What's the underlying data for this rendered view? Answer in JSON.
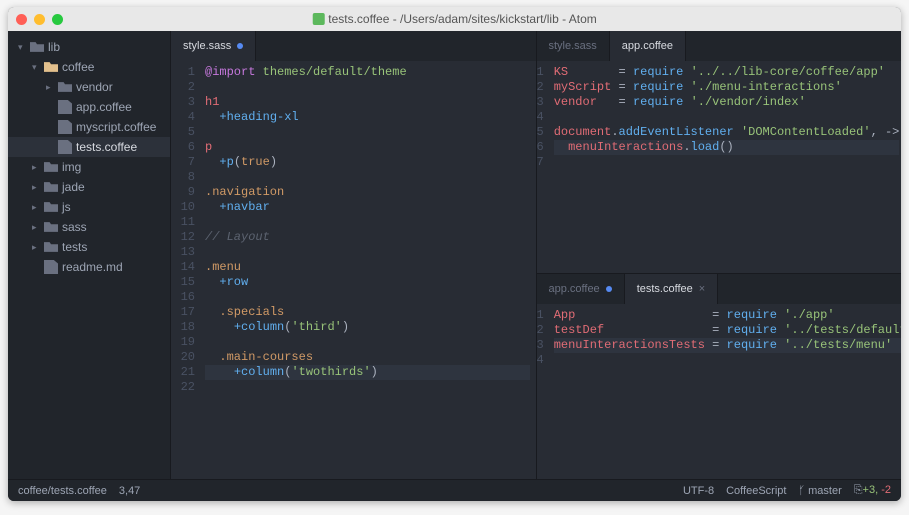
{
  "window": {
    "title": "tests.coffee - /Users/adam/sites/kickstart/lib - Atom"
  },
  "sidebar": {
    "items": [
      {
        "label": "lib",
        "type": "folder",
        "open": true,
        "indent": 0,
        "chev": "▾"
      },
      {
        "label": "coffee",
        "type": "folder-open",
        "open": true,
        "indent": 1,
        "chev": "▾"
      },
      {
        "label": "vendor",
        "type": "folder",
        "open": false,
        "indent": 2,
        "chev": "▸"
      },
      {
        "label": "app.coffee",
        "type": "file",
        "indent": 2
      },
      {
        "label": "myscript.coffee",
        "type": "file",
        "indent": 2
      },
      {
        "label": "tests.coffee",
        "type": "file",
        "indent": 2,
        "selected": true
      },
      {
        "label": "img",
        "type": "folder",
        "open": false,
        "indent": 1,
        "chev": "▸"
      },
      {
        "label": "jade",
        "type": "folder",
        "open": false,
        "indent": 1,
        "chev": "▸"
      },
      {
        "label": "js",
        "type": "folder",
        "open": false,
        "indent": 1,
        "chev": "▸"
      },
      {
        "label": "sass",
        "type": "folder",
        "open": false,
        "indent": 1,
        "chev": "▸"
      },
      {
        "label": "tests",
        "type": "folder",
        "open": false,
        "indent": 1,
        "chev": "▸"
      },
      {
        "label": "readme.md",
        "type": "file",
        "indent": 1
      }
    ]
  },
  "leftPane": {
    "tabs": [
      {
        "label": "style.sass",
        "active": true,
        "modified": true
      }
    ],
    "lines": [
      {
        "n": "1",
        "html": "<span class='c-kw'>@import</span> <span class='c-str'>themes/default/theme</span>"
      },
      {
        "n": "2",
        "html": ""
      },
      {
        "n": "3",
        "html": "<span class='c-tag'>h1</span>"
      },
      {
        "n": "4",
        "html": "  <span class='c-mix'>+heading-xl</span>"
      },
      {
        "n": "5",
        "html": ""
      },
      {
        "n": "6",
        "html": "<span class='c-tag'>p</span>"
      },
      {
        "n": "7",
        "html": "  <span class='c-mix'>+p</span>(<span class='c-bool'>true</span>)"
      },
      {
        "n": "8",
        "html": ""
      },
      {
        "n": "9",
        "html": "<span class='c-class'>.navigation</span>"
      },
      {
        "n": "10",
        "html": "  <span class='c-mix'>+navbar</span>"
      },
      {
        "n": "11",
        "html": ""
      },
      {
        "n": "12",
        "html": "<span class='c-comment'>// Layout</span>"
      },
      {
        "n": "13",
        "html": ""
      },
      {
        "n": "14",
        "html": "<span class='c-class'>.menu</span>"
      },
      {
        "n": "15",
        "html": "  <span class='c-mix'>+row</span>"
      },
      {
        "n": "16",
        "html": ""
      },
      {
        "n": "17",
        "html": "  <span class='c-class'>.specials</span>"
      },
      {
        "n": "18",
        "html": "    <span class='c-mix'>+column</span>(<span class='c-str'>'third'</span>)"
      },
      {
        "n": "19",
        "html": ""
      },
      {
        "n": "20",
        "html": "  <span class='c-class'>.main-courses</span>"
      },
      {
        "n": "21",
        "html": "    <span class='c-mix'>+column</span>(<span class='c-str'>'twothirds'</span>)",
        "hl": true
      },
      {
        "n": "22",
        "html": ""
      }
    ]
  },
  "topRightPane": {
    "tabs": [
      {
        "label": "style.sass",
        "active": false
      },
      {
        "label": "app.coffee",
        "active": true
      }
    ],
    "lines": [
      {
        "n": "1",
        "html": "<span class='c-var'>KS</span>       <span class='c-op'>=</span> <span class='c-func'>require</span> <span class='c-str'>'../../lib-core/coffee/app'</span>"
      },
      {
        "n": "2",
        "html": "<span class='c-var'>myScript</span> <span class='c-op'>=</span> <span class='c-func'>require</span> <span class='c-str'>'./menu-interactions'</span>"
      },
      {
        "n": "3",
        "html": "<span class='c-var'>vendor</span>   <span class='c-op'>=</span> <span class='c-func'>require</span> <span class='c-str'>'./vendor/index'</span>"
      },
      {
        "n": "4",
        "html": ""
      },
      {
        "n": "5",
        "html": "<span class='c-var'>document</span>.<span class='c-func'>addEventListener</span> <span class='c-str'>'DOMContentLoaded'</span>, <span class='c-op'>-&gt;</span>"
      },
      {
        "n": "6",
        "html": "  <span class='c-var'>menuInteractions</span>.<span class='c-func'>load</span>()",
        "hl": true
      },
      {
        "n": "7",
        "html": ""
      }
    ]
  },
  "bottomRightPane": {
    "tabs": [
      {
        "label": "app.coffee",
        "active": false,
        "modified": true
      },
      {
        "label": "tests.coffee",
        "active": true,
        "close": true
      }
    ],
    "lines": [
      {
        "n": "1",
        "html": "<span class='c-var'>App</span>                   <span class='c-op'>=</span> <span class='c-func'>require</span> <span class='c-str'>'./app'</span>"
      },
      {
        "n": "2",
        "html": "<span class='c-var'>testDef</span>               <span class='c-op'>=</span> <span class='c-func'>require</span> <span class='c-str'>'../tests/default'</span>"
      },
      {
        "n": "3",
        "html": "<span class='c-var'>menuInteractionsTests</span> <span class='c-op'>=</span> <span class='c-func'>require</span> <span class='c-str'>'../tests/menu'</span>",
        "hl": true
      },
      {
        "n": "4",
        "html": ""
      }
    ]
  },
  "status": {
    "path": "coffee/tests.coffee",
    "cursor": "3,47",
    "encoding": "UTF-8",
    "grammar": "CoffeeScript",
    "branch": "master",
    "gitplus": "+3,",
    "gitminus": "-2"
  }
}
